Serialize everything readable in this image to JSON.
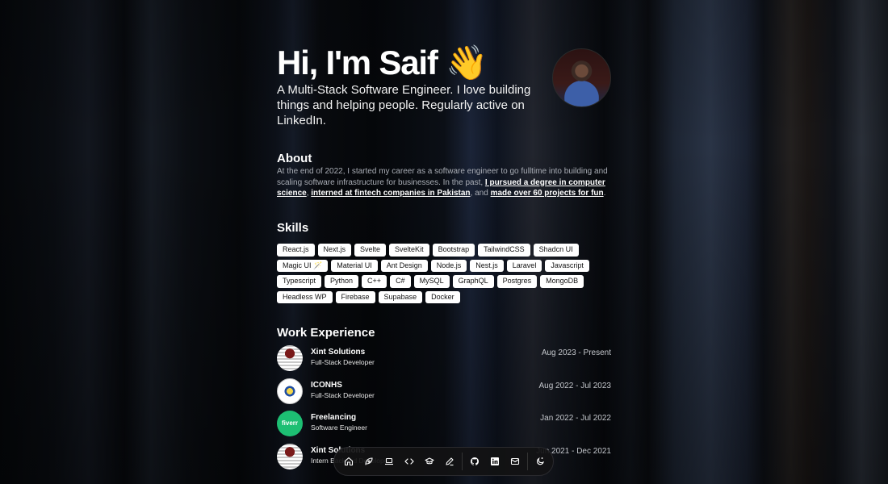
{
  "hero": {
    "title": "Hi, I'm Saif 👋",
    "subtitle": "A Multi-Stack Software Engineer. I love building things and helping people. Regularly active on LinkedIn."
  },
  "about": {
    "title": "About",
    "text_1": "At the end of 2022, I started my career as a software engineer to go fulltime into building and scaling software infrastructure for businesses. In the past, ",
    "link_1": "I pursued a degree in computer science",
    "text_2": ", ",
    "link_2": "interned at fintech companies in Pakistan",
    "text_3": ", and ",
    "link_3": "made over 60 projects for fun",
    "text_4": "."
  },
  "skills": {
    "title": "Skills",
    "items": [
      "React.js",
      "Next.js",
      "Svelte",
      "SvelteKit",
      "Bootstrap",
      "TailwindCSS",
      "Shadcn UI",
      "Magic UI 🪄",
      "Material UI",
      "Ant Design",
      "Node.js",
      "Nest.js",
      "Laravel",
      "Javascript",
      "Typescript",
      "Python",
      "C++",
      "C#",
      "MySQL",
      "GraphQL",
      "Postgres",
      "MongoDB",
      "Headless WP",
      "Firebase",
      "Supabase",
      "Docker"
    ]
  },
  "work": {
    "title": "Work Experience",
    "items": [
      {
        "company": "Xint Solutions",
        "role": "Full-Stack Developer",
        "dates": "Aug 2023 - Present",
        "logo": "xint"
      },
      {
        "company": "ICONHS",
        "role": "Full-Stack Developer",
        "dates": "Aug 2022 - Jul 2023",
        "logo": "iconhs"
      },
      {
        "company": "Freelancing",
        "role": "Software Engineer",
        "dates": "Jan 2022 - Jul 2022",
        "logo": "fiverr",
        "logo_text": "fiverr"
      },
      {
        "company": "Xint Solutions",
        "role": "Intern Backend Developer",
        "dates": "Jun 2021 - Dec 2021",
        "logo": "xint"
      }
    ]
  },
  "dock": {
    "items": [
      "home-icon",
      "pen-nib-icon",
      "laptop-icon",
      "code-icon",
      "graduation-cap-icon",
      "pencil-icon",
      "github-icon",
      "linkedin-icon",
      "mail-icon",
      "theme-toggle-icon"
    ]
  }
}
